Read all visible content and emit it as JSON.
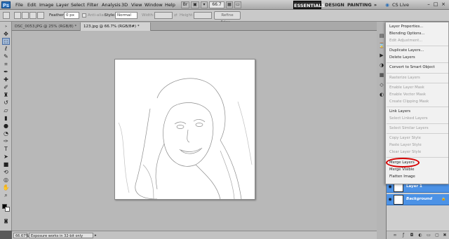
{
  "menubar": {
    "logo": "Ps",
    "items": [
      "File",
      "Edit",
      "Image",
      "Layer",
      "Select",
      "Filter",
      "Analysis",
      "3D",
      "View",
      "Window",
      "Help"
    ],
    "zoom": "66.7",
    "workspaces": [
      "ESSENTIALS",
      "DESIGN",
      "PAINTING"
    ],
    "more": "»",
    "cslive": "CS Live"
  },
  "optbar": {
    "feather_label": "Feather:",
    "feather_value": "0 px",
    "antialias_label": "Anti-alias",
    "style_label": "Style:",
    "style_value": "Normal",
    "width_label": "Width:",
    "height_label": "Height:",
    "refine_edge": "Refine Edge..."
  },
  "tabs": [
    {
      "label": "DSC_0053.JPG @ 25% (RGB/8) *"
    },
    {
      "label": "123.jpg @ 66.7% (RGB/8#) *"
    }
  ],
  "status": {
    "zoom": "66.67%",
    "info": "Exposure works in 32-bit only"
  },
  "context_menu": {
    "items": [
      {
        "label": "Layer Properties...",
        "enabled": true
      },
      {
        "label": "Blending Options...",
        "enabled": true
      },
      {
        "label": "Edit Adjustment...",
        "enabled": false
      },
      {
        "label": "Duplicate Layers...",
        "enabled": true
      },
      {
        "label": "Delete Layers",
        "enabled": true
      },
      {
        "label": "Convert to Smart Object",
        "enabled": true
      },
      {
        "label": "Rasterize Layers",
        "enabled": false
      },
      {
        "label": "Enable Layer Mask",
        "enabled": false
      },
      {
        "label": "Enable Vector Mask",
        "enabled": false
      },
      {
        "label": "Create Clipping Mask",
        "enabled": false
      },
      {
        "label": "Link Layers",
        "enabled": true
      },
      {
        "label": "Select Linked Layers",
        "enabled": false
      },
      {
        "label": "Select Similar Layers",
        "enabled": false
      },
      {
        "label": "Copy Layer Style",
        "enabled": false
      },
      {
        "label": "Paste Layer Style",
        "enabled": false
      },
      {
        "label": "Clear Layer Style",
        "enabled": false
      },
      {
        "label": "Merge Layers",
        "enabled": true
      },
      {
        "label": "Merge Visible",
        "enabled": true
      },
      {
        "label": "Flatten Image",
        "enabled": true
      }
    ]
  },
  "layers": [
    {
      "name": "Layer 1",
      "locked": false
    },
    {
      "name": "Background",
      "locked": true
    }
  ],
  "colors": {
    "accent": "#4c92e6",
    "highlight_ring": "#d40000"
  }
}
